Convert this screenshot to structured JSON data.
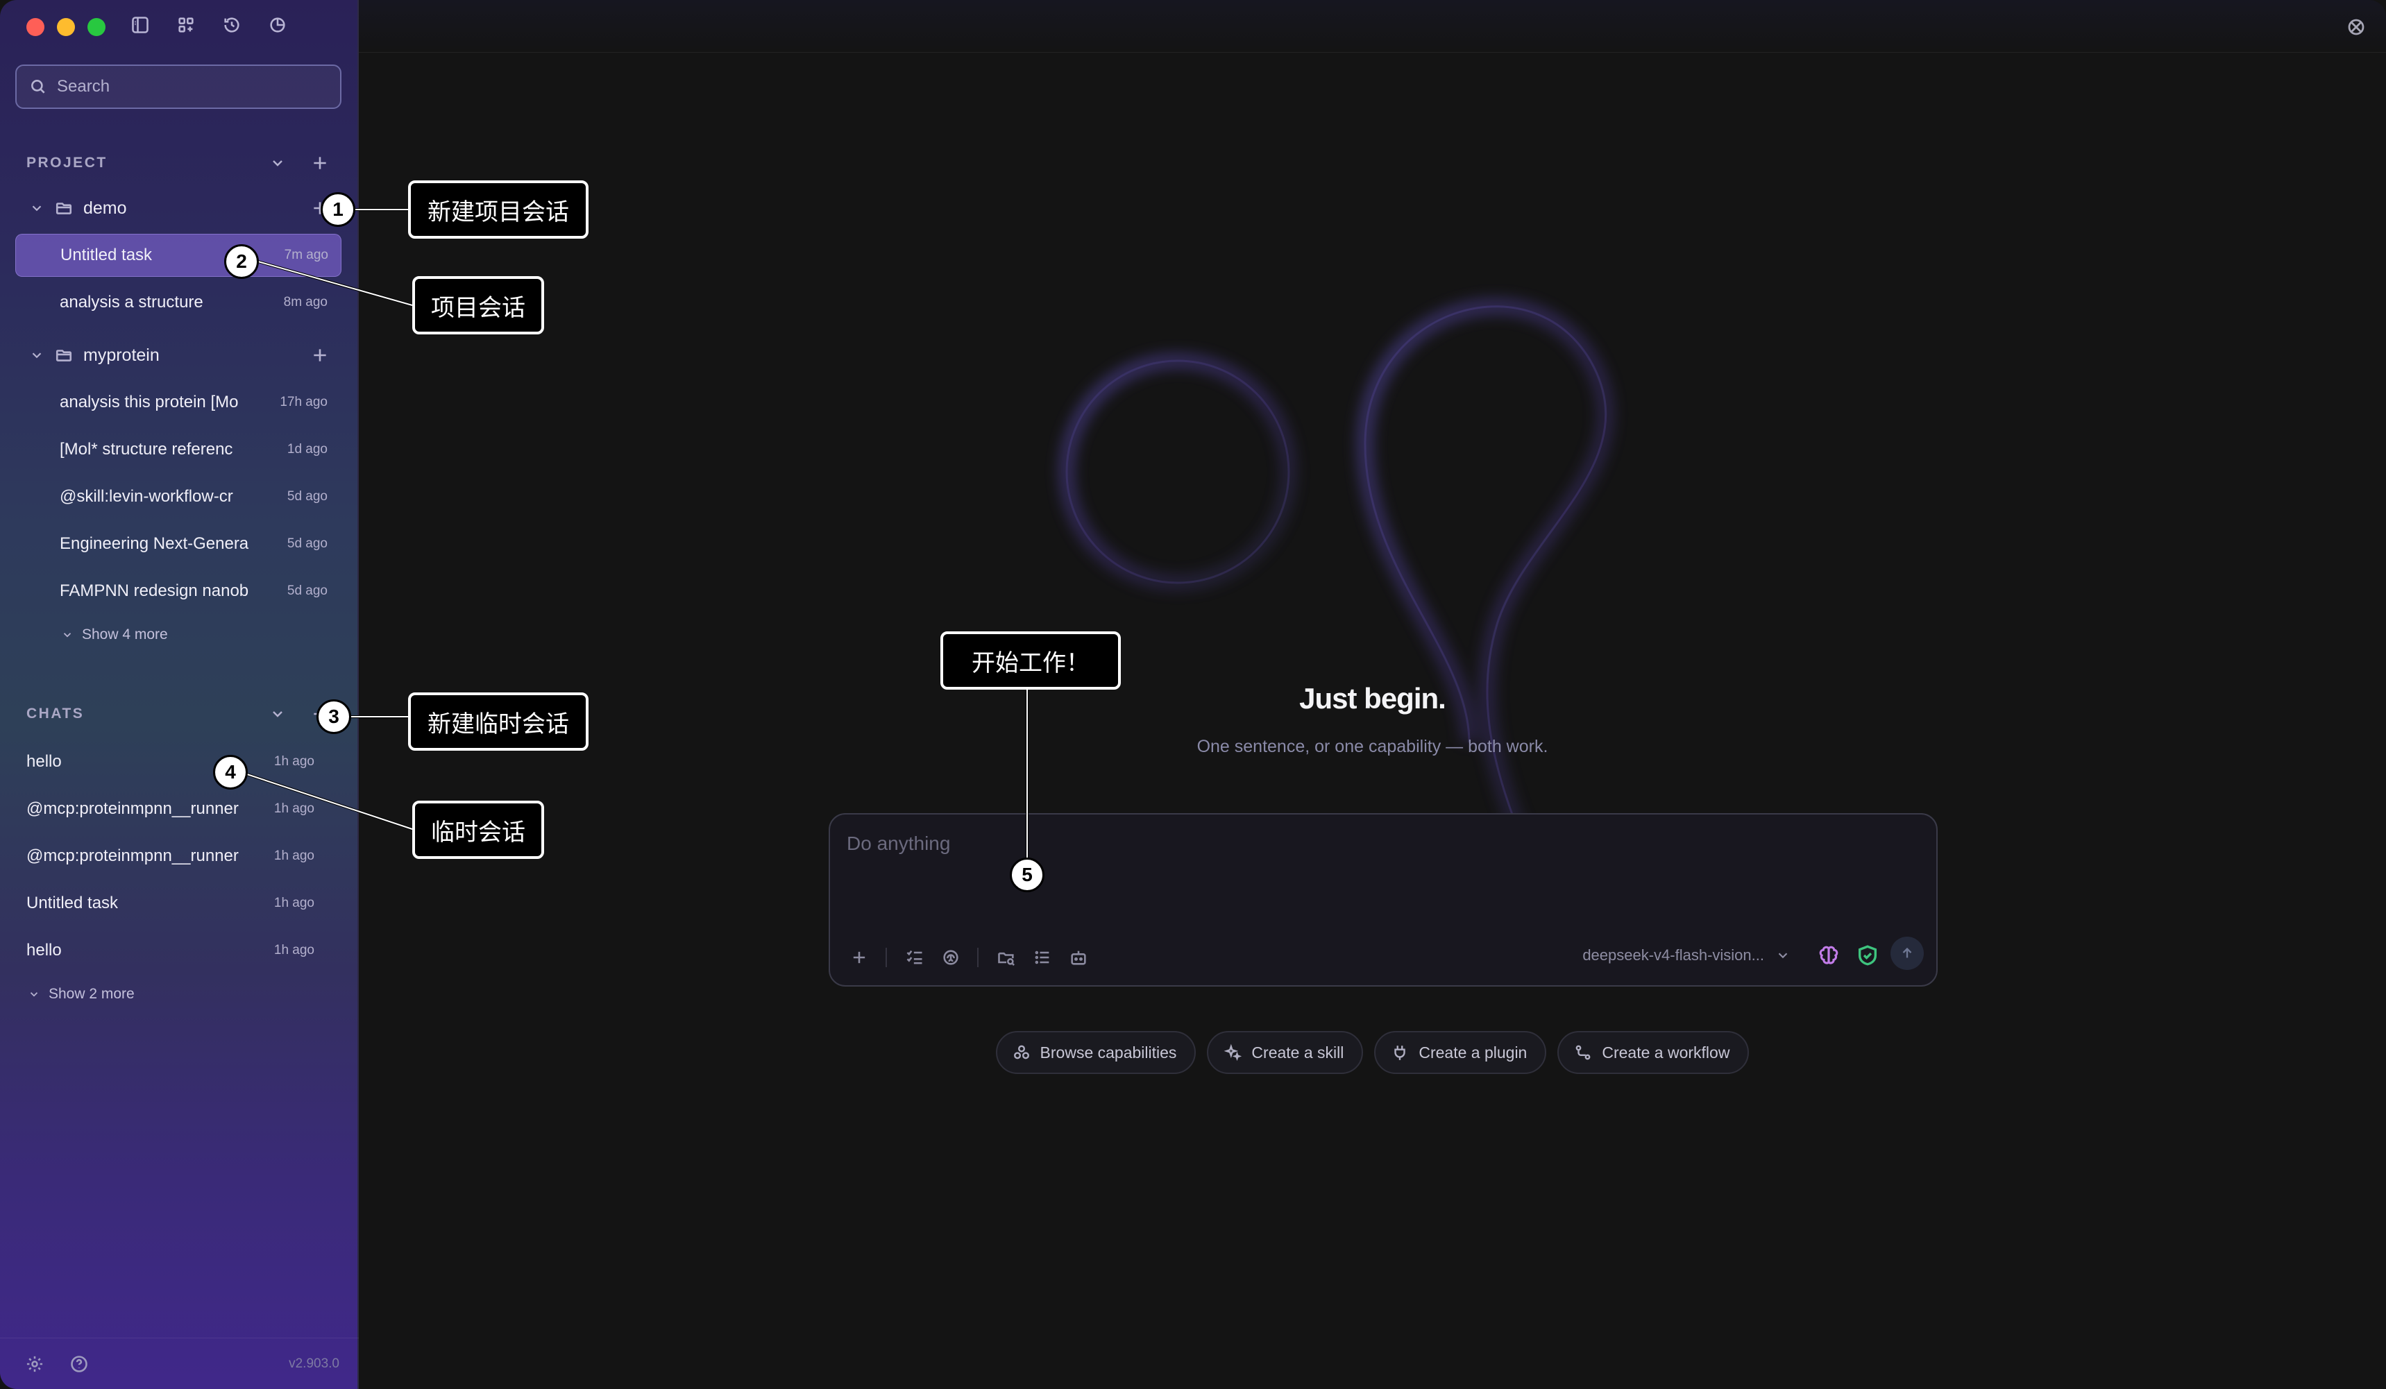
{
  "sidebar": {
    "search_placeholder": "Search",
    "project_section": {
      "label": "PROJECT",
      "folders": [
        {
          "name": "demo",
          "tasks": [
            {
              "title": "Untitled task",
              "time": "7m ago",
              "active": true
            },
            {
              "title": "analysis a structure",
              "time": "8m ago",
              "active": false
            }
          ]
        },
        {
          "name": "myprotein",
          "tasks": [
            {
              "title": "analysis this protein [Mo",
              "time": "17h ago"
            },
            {
              "title": "[Mol* structure referenc",
              "time": "1d ago"
            },
            {
              "title": "@skill:levin-workflow-cr",
              "time": "5d ago"
            },
            {
              "title": "Engineering Next-Genera",
              "time": "5d ago"
            },
            {
              "title": "FAMPNN redesign nanob",
              "time": "5d ago"
            }
          ],
          "show_more": "Show 4 more"
        }
      ]
    },
    "chats_section": {
      "label": "CHATS",
      "items": [
        {
          "title": "hello",
          "time": "1h ago"
        },
        {
          "title": "@mcp:proteinmpnn__runner",
          "time": "1h ago"
        },
        {
          "title": "@mcp:proteinmpnn__runner",
          "time": "1h ago"
        },
        {
          "title": "Untitled task",
          "time": "1h ago"
        },
        {
          "title": "hello",
          "time": "1h ago"
        }
      ],
      "show_more": "Show 2 more"
    },
    "version": "v2.903.0"
  },
  "main": {
    "hero_title": "Just begin.",
    "hero_subtitle": "One sentence, or one capability — both work.",
    "composer": {
      "placeholder": "Do anything",
      "model": "deepseek-v4-flash-vision..."
    },
    "chips": [
      {
        "label": "Browse capabilities",
        "icon": "capabilities-icon"
      },
      {
        "label": "Create a skill",
        "icon": "sparkle-icon"
      },
      {
        "label": "Create a plugin",
        "icon": "plug-icon"
      },
      {
        "label": "Create a workflow",
        "icon": "workflow-icon"
      }
    ]
  },
  "callouts": [
    {
      "num": "1",
      "text": "新建项目会话"
    },
    {
      "num": "2",
      "text": "项目会话"
    },
    {
      "num": "3",
      "text": "新建临时会话"
    },
    {
      "num": "4",
      "text": "临时会话"
    },
    {
      "num": "5",
      "text": "开始工作！"
    }
  ],
  "colors": {
    "accent_active": "#8c6ee6",
    "brain": "#c27ce8",
    "shield": "#3ec47e"
  }
}
